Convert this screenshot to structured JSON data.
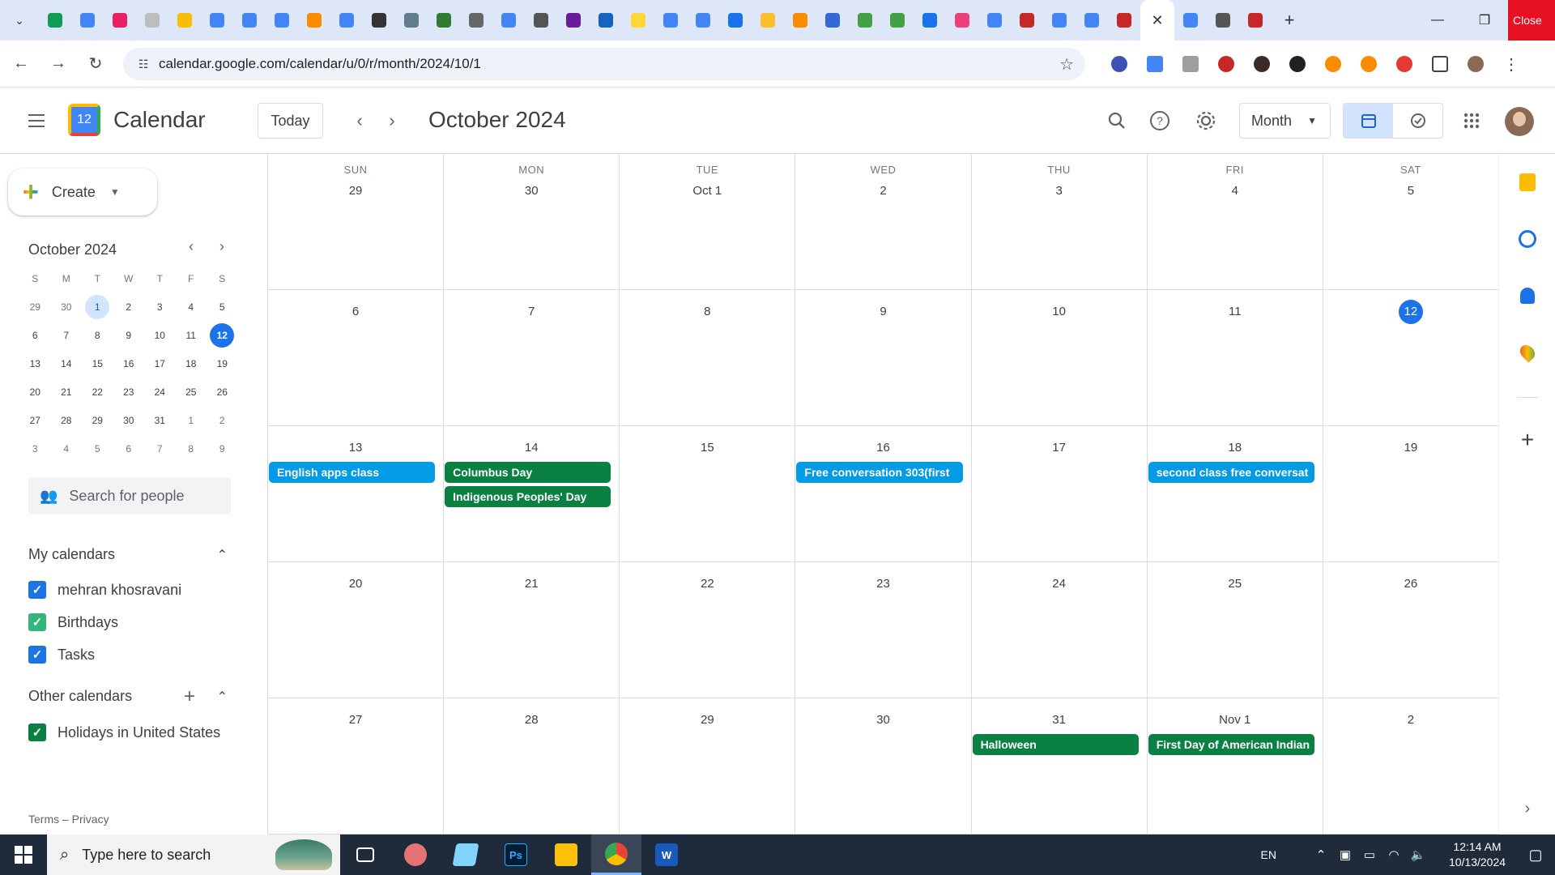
{
  "browser": {
    "url": "calendar.google.com/calendar/u/0/r/month/2024/10/1",
    "close_tooltip": "Close",
    "tab_favicon_colors": [
      "#0f9d58",
      "#4285f4",
      "#e91e63",
      "#bdbdbd",
      "#fbbc04",
      "#4285f4",
      "#4285f4",
      "#4285f4",
      "#fb8c00",
      "#4285f4",
      "#333333",
      "#607d8b",
      "#2e7d32",
      "#666666",
      "#4285f4",
      "#555555",
      "#6a1b9a",
      "#1565c0",
      "#fdd835",
      "#4285f4",
      "#4285f4",
      "#1a73e8",
      "#fbc02d",
      "#fb8c00",
      "#3367d6",
      "#43a047",
      "#43a047",
      "#1a73e8",
      "#ec407a",
      "#4285f4",
      "#c62828",
      "#4285f4",
      "#4285f4",
      "#c62828",
      "#4285f4",
      "#555555",
      "#c62828"
    ]
  },
  "calendar": {
    "app_name": "Calendar",
    "logo_day": "12",
    "today_label": "Today",
    "month_title": "October 2024",
    "view_label": "Month",
    "create_label": "Create",
    "mini": {
      "title": "October 2024",
      "weekday_heads": [
        "S",
        "M",
        "T",
        "W",
        "T",
        "F",
        "S"
      ],
      "weeks": [
        [
          "29",
          "30",
          "1",
          "2",
          "3",
          "4",
          "5"
        ],
        [
          "6",
          "7",
          "8",
          "9",
          "10",
          "11",
          "12"
        ],
        [
          "13",
          "14",
          "15",
          "16",
          "17",
          "18",
          "19"
        ],
        [
          "20",
          "21",
          "22",
          "23",
          "24",
          "25",
          "26"
        ],
        [
          "27",
          "28",
          "29",
          "30",
          "31",
          "1",
          "2"
        ],
        [
          "3",
          "4",
          "5",
          "6",
          "7",
          "8",
          "9"
        ]
      ]
    },
    "search_people_placeholder": "Search for people",
    "my_calendars_title": "My calendars",
    "my_calendars": [
      {
        "name": "mehran khosravani",
        "color": "#1a73e8"
      },
      {
        "name": "Birthdays",
        "color": "#33b679"
      },
      {
        "name": "Tasks",
        "color": "#1a73e8"
      }
    ],
    "other_calendars_title": "Other calendars",
    "other_calendars": [
      {
        "name": "Holidays in United States",
        "color": "#0b8043"
      }
    ],
    "footer": "Terms – Privacy",
    "weekdays": [
      "SUN",
      "MON",
      "TUE",
      "WED",
      "THU",
      "FRI",
      "SAT"
    ],
    "weeks": [
      [
        "29",
        "30",
        "Oct 1",
        "2",
        "3",
        "4",
        "5"
      ],
      [
        "6",
        "7",
        "8",
        "9",
        "10",
        "11",
        "12"
      ],
      [
        "13",
        "14",
        "15",
        "16",
        "17",
        "18",
        "19"
      ],
      [
        "20",
        "21",
        "22",
        "23",
        "24",
        "25",
        "26"
      ],
      [
        "27",
        "28",
        "29",
        "30",
        "31",
        "Nov 1",
        "2"
      ]
    ],
    "events": [
      {
        "title": "English apps class",
        "week": 2,
        "day": 0,
        "slot": 0,
        "color": "#039be5"
      },
      {
        "title": "Columbus Day",
        "week": 2,
        "day": 1,
        "slot": 0,
        "color": "#0b8043"
      },
      {
        "title": "Indigenous Peoples' Day",
        "week": 2,
        "day": 1,
        "slot": 1,
        "color": "#0b8043"
      },
      {
        "title": "Free conversation 303(first",
        "week": 2,
        "day": 3,
        "slot": 0,
        "color": "#039be5"
      },
      {
        "title": "second class free conversat",
        "week": 2,
        "day": 5,
        "slot": 0,
        "color": "#039be5"
      },
      {
        "title": "Halloween",
        "week": 4,
        "day": 4,
        "slot": 0,
        "color": "#0b8043"
      },
      {
        "title": "First Day of American Indian",
        "week": 4,
        "day": 5,
        "slot": 0,
        "color": "#0b8043"
      }
    ]
  },
  "taskbar": {
    "search_placeholder": "Type here to search",
    "language": "EN",
    "time": "12:14 AM",
    "date": "10/13/2024"
  }
}
